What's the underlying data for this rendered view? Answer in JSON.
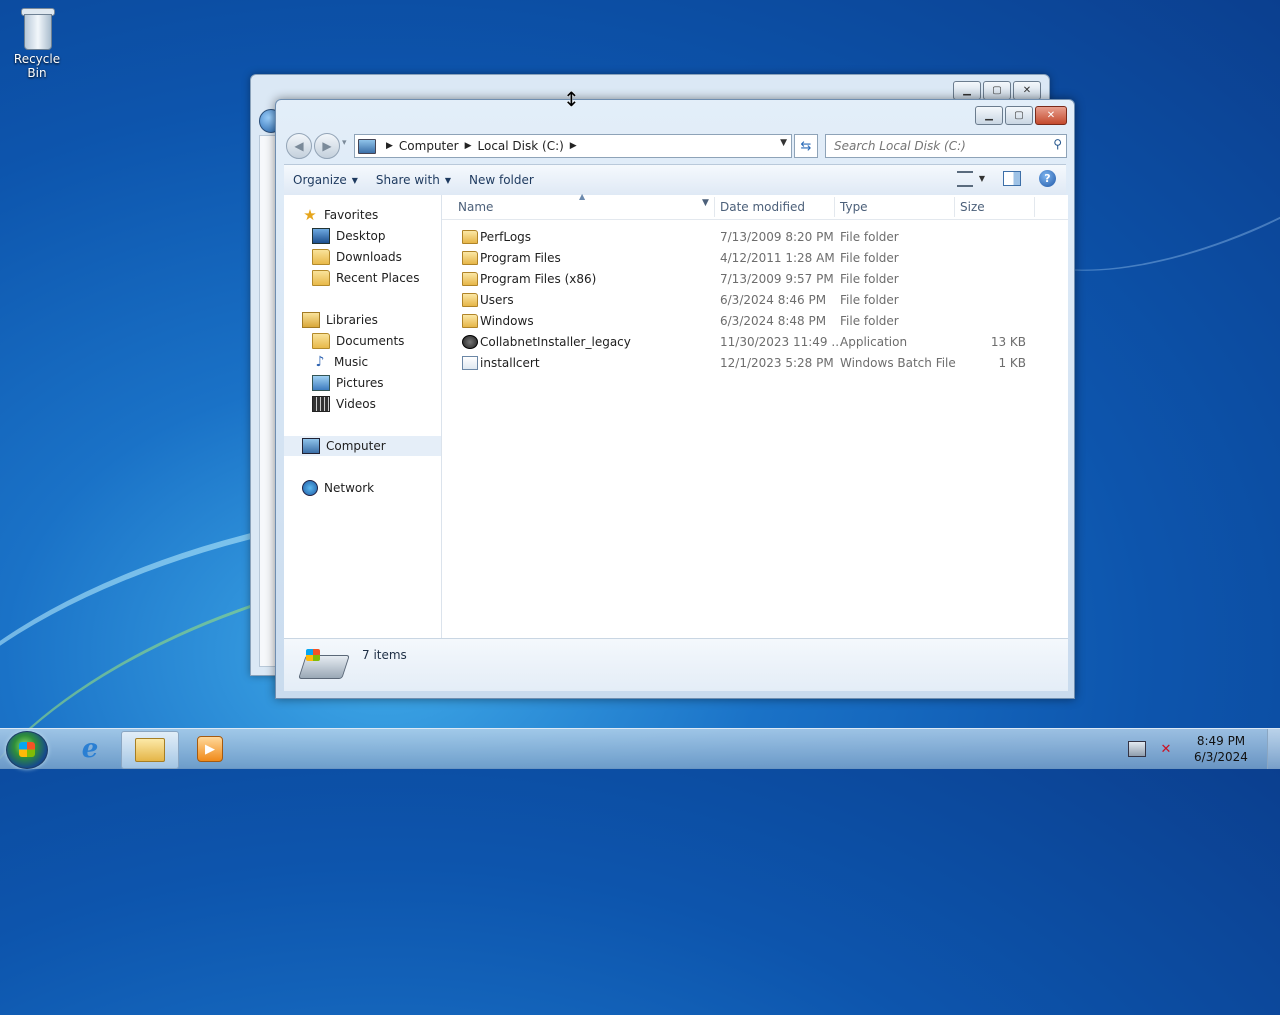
{
  "desktop": {
    "icons": [
      {
        "label": "Recycle Bin",
        "icon": "recycle-bin-icon"
      }
    ]
  },
  "explorer": {
    "address": {
      "crumbs": [
        "Computer",
        "Local Disk (C:)"
      ]
    },
    "search": {
      "placeholder": "Search Local Disk (C:)"
    },
    "toolbar": {
      "organize": "Organize",
      "share_with": "Share with",
      "new_folder": "New folder"
    },
    "nav": {
      "favorites": "Favorites",
      "desktop": "Desktop",
      "downloads": "Downloads",
      "recent_places": "Recent Places",
      "libraries": "Libraries",
      "documents": "Documents",
      "music": "Music",
      "pictures": "Pictures",
      "videos": "Videos",
      "computer": "Computer",
      "network": "Network"
    },
    "columns": {
      "name": "Name",
      "date_modified": "Date modified",
      "type": "Type",
      "size": "Size"
    },
    "files": [
      {
        "name": "PerfLogs",
        "date": "7/13/2009 8:20 PM",
        "type": "File folder",
        "size": "",
        "icon": "folder-icon"
      },
      {
        "name": "Program Files",
        "date": "4/12/2011 1:28 AM",
        "type": "File folder",
        "size": "",
        "icon": "folder-icon"
      },
      {
        "name": "Program Files (x86)",
        "date": "7/13/2009 9:57 PM",
        "type": "File folder",
        "size": "",
        "icon": "folder-icon"
      },
      {
        "name": "Users",
        "date": "6/3/2024 8:46 PM",
        "type": "File folder",
        "size": "",
        "icon": "folder-icon"
      },
      {
        "name": "Windows",
        "date": "6/3/2024 8:48 PM",
        "type": "File folder",
        "size": "",
        "icon": "folder-icon"
      },
      {
        "name": "CollabnetInstaller_legacy",
        "date": "11/30/2023 11:49 ...",
        "type": "Application",
        "size": "13 KB",
        "icon": "application-icon"
      },
      {
        "name": "installcert",
        "date": "12/1/2023 5:28 PM",
        "type": "Windows Batch File",
        "size": "1 KB",
        "icon": "batch-file-icon"
      }
    ],
    "status": {
      "item_count": "7 items"
    }
  },
  "taskbar": {
    "clock_time": "8:49 PM",
    "clock_date": "6/3/2024"
  }
}
